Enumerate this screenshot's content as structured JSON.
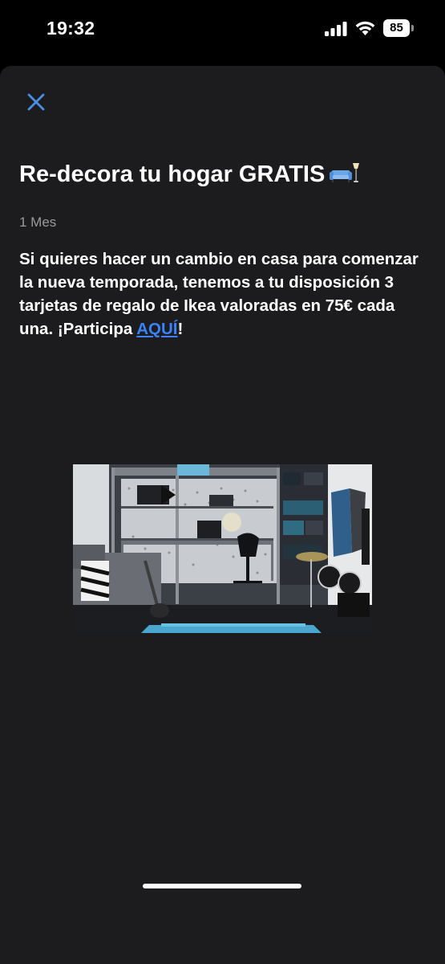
{
  "status_bar": {
    "time": "19:32",
    "battery": "85"
  },
  "post": {
    "title": "Re-decora tu hogar GRATIS",
    "title_emoji": "couch-and-lamp-icon",
    "timestamp": "1 Mes",
    "body_text": "Si quieres hacer un cambio en casa para comenzar la nueva temporada, tenemos a tu disposición 3 tarjetas de regalo de Ikea valoradas en 75€ cada una. ¡Participa ",
    "link_text": "AQUÍ",
    "body_end": "!",
    "image": "bedroom-loft-photo"
  },
  "colors": {
    "background": "#1c1c1e",
    "accent": "#3b82f6",
    "text": "#ffffff",
    "muted": "#9a9a9f"
  }
}
